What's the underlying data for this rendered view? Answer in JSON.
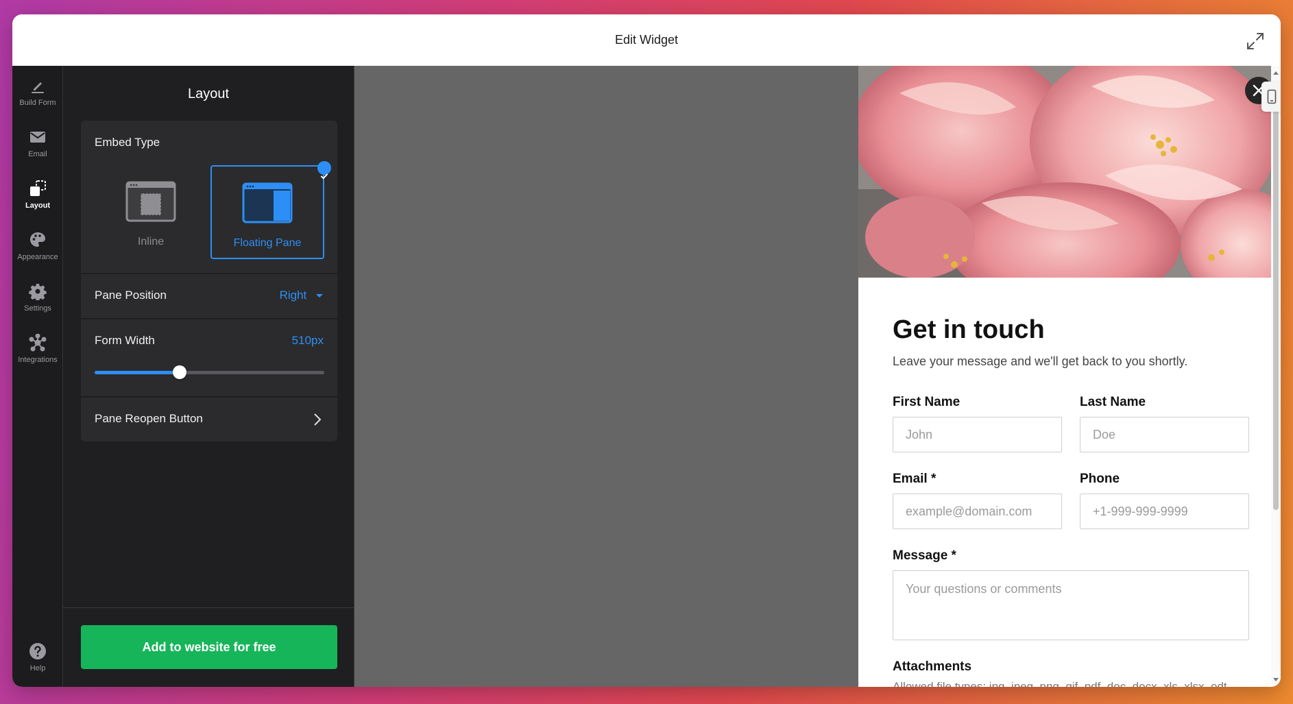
{
  "window": {
    "title": "Edit Widget"
  },
  "sidebar": {
    "items": [
      {
        "label": "Build Form",
        "icon": "pencil-icon"
      },
      {
        "label": "Email",
        "icon": "envelope-icon"
      },
      {
        "label": "Layout",
        "icon": "layout-icon",
        "active": true
      },
      {
        "label": "Appearance",
        "icon": "palette-icon"
      },
      {
        "label": "Settings",
        "icon": "gear-icon"
      },
      {
        "label": "Integrations",
        "icon": "integrations-icon"
      }
    ],
    "help": {
      "label": "Help",
      "icon": "help-icon"
    }
  },
  "panel": {
    "title": "Layout",
    "embed_type": {
      "label": "Embed Type",
      "options": [
        {
          "label": "Inline",
          "selected": false
        },
        {
          "label": "Floating Pane",
          "selected": true
        }
      ]
    },
    "pane_position": {
      "label": "Pane Position",
      "value": "Right"
    },
    "form_width": {
      "label": "Form Width",
      "value": "510px",
      "slider_fraction": 0.37
    },
    "pane_reopen": {
      "label": "Pane Reopen Button"
    },
    "cta": "Add to website for free"
  },
  "preview": {
    "title": "Get in touch",
    "subtitle": "Leave your message and we'll get back to you shortly.",
    "fields": {
      "first_name": {
        "label": "First Name",
        "placeholder": "John"
      },
      "last_name": {
        "label": "Last Name",
        "placeholder": "Doe"
      },
      "email": {
        "label": "Email *",
        "placeholder": "example@domain.com"
      },
      "phone": {
        "label": "Phone",
        "placeholder": "+1-999-999-9999"
      },
      "message": {
        "label": "Message *",
        "placeholder": "Your questions or comments"
      },
      "attachments": {
        "label": "Attachments",
        "helper": "Allowed file types: jpg, jpeg, png, gif, pdf, doc, docx, xls, xlsx, odt,"
      }
    }
  },
  "colors": {
    "accent": "#2d8ff5",
    "cta": "#17b55a",
    "panel_bg": "#1f1f21",
    "canvas_bg": "#666666"
  }
}
